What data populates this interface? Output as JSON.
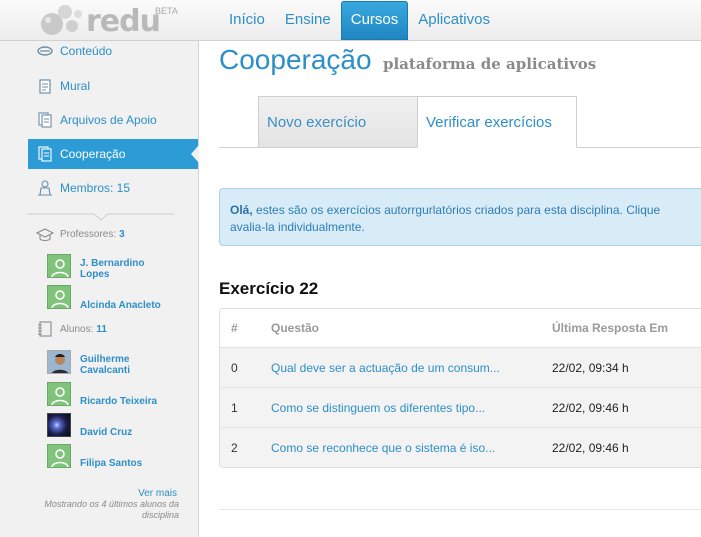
{
  "logo": {
    "text": "redu",
    "beta": "BETA"
  },
  "nav": [
    {
      "label": "Início",
      "active": false
    },
    {
      "label": "Ensine",
      "active": false
    },
    {
      "label": "Cursos",
      "active": true
    },
    {
      "label": "Aplicativos",
      "active": false
    }
  ],
  "sidebar": {
    "items": [
      {
        "label": "Conteúdo",
        "icon": "content-icon"
      },
      {
        "label": "Mural",
        "icon": "wall-icon"
      },
      {
        "label": "Arquivos de Apoio",
        "icon": "files-icon"
      },
      {
        "label": "Cooperação",
        "icon": "cooperation-icon",
        "active": true
      },
      {
        "label": "Membros: 15",
        "icon": "members-icon"
      }
    ],
    "professores": {
      "label": "Professores:",
      "count": "3"
    },
    "teachers": [
      "J. Bernardino Lopes",
      "Alcinda Anacleto"
    ],
    "alunos": {
      "label": "Alunos:",
      "count": "11"
    },
    "students": [
      "Guilherme Cavalcanti",
      "Ricardo Teixeira",
      "David Cruz",
      "Filipa Santos"
    ],
    "see_more": "Ver mais",
    "note": "Mostrando os 4 últimos alunos da disciplina"
  },
  "page": {
    "title": "Cooperação",
    "subtitle": "plataforma de aplicativos",
    "tabs": [
      {
        "label": "Novo exercício",
        "active": false
      },
      {
        "label": "Verificar exercícios",
        "active": true
      }
    ],
    "info_bold": "Olá,",
    "info_line1": " estes são os exercícios autorrgurlatórios criados para esta disciplina. Clique",
    "info_line2": "avalia-la individualmente."
  },
  "exercise": {
    "title": "Exercício 22",
    "headers": [
      "#",
      "Questão",
      "Última Resposta Em"
    ],
    "rows": [
      [
        "0",
        "Qual deve ser a actuação de um consum...",
        "22/02, 09:34 h"
      ],
      [
        "1",
        "Como se distinguem os diferentes tipo...",
        "22/02, 09:46 h"
      ],
      [
        "2",
        "Como se reconhece que o sistema é iso...",
        "22/02, 09:46 h"
      ]
    ]
  },
  "colors": {
    "accent": "#2d8fc8",
    "active_blue": "#2d9bd6",
    "avatar_green": "#7fc47a"
  }
}
